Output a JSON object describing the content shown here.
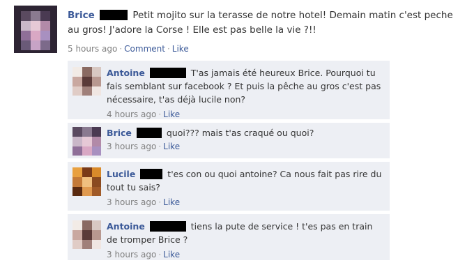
{
  "post": {
    "author": "Brice",
    "text": "Petit mojito sur la terasse de notre hotel! Demain matin c'est peche au gros! J'adore la Corse ! Elle est pas belle la vie ?!!",
    "time": "5 hours ago",
    "comment_label": "Comment",
    "like_label": "Like"
  },
  "comments": [
    {
      "author": "Antoine",
      "text": "T'as jamais été heureux Brice. Pourquoi tu fais semblant sur facebook ? Et puis la pêche au gros c'est pas nécessaire, t'as déjà lucile non?",
      "time": "4 hours ago",
      "like_label": "Like"
    },
    {
      "author": "Brice",
      "text": "quoi??? mais t'as craqué ou quoi?",
      "time": "3 hours ago",
      "like_label": "Like"
    },
    {
      "author": "Lucile",
      "text": "t'es con ou quoi antoine? Ca nous fait pas rire du tout tu sais?",
      "time": "3 hours ago",
      "like_label": "Like"
    },
    {
      "author": "Antoine",
      "text": "tiens la pute de service ! t'es pas en train de tromper Brice ?",
      "time": "3 hours ago",
      "like_label": "Like"
    }
  ],
  "colors": {
    "link_blue": "#3b5998",
    "comment_bg": "#edeff4",
    "meta_gray": "#808080",
    "redaction": "#000000"
  }
}
